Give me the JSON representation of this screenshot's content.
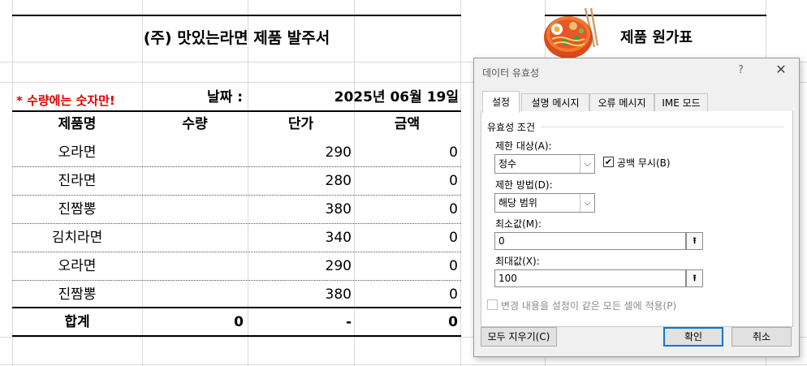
{
  "sheet": {
    "title": "(주) 맛있는라면 제품 발주서",
    "cost_table_title": "제품 원가표",
    "note": "* 수량에는 숫자만!",
    "date_label": "날짜 :",
    "date_value": "2025년 06월 19일",
    "note_color": "#e00000",
    "headers": [
      "제품명",
      "수량",
      "단가",
      "금액"
    ],
    "rows": [
      {
        "name": "오라면",
        "qty": "",
        "price": "290",
        "amount": "0"
      },
      {
        "name": "진라면",
        "qty": "",
        "price": "280",
        "amount": "0"
      },
      {
        "name": "진짬뽕",
        "qty": "",
        "price": "380",
        "amount": "0"
      },
      {
        "name": "김치라면",
        "qty": "",
        "price": "340",
        "amount": "0"
      },
      {
        "name": "오라면",
        "qty": "",
        "price": "290",
        "amount": "0"
      },
      {
        "name": "진짬뽕",
        "qty": "",
        "price": "380",
        "amount": "0"
      }
    ],
    "total": {
      "label": "합계",
      "qty": "0",
      "price": "-",
      "amount": "0"
    },
    "icon": "ramen-bowl-icon"
  },
  "dialog": {
    "title": "데이터 유효성",
    "help": "?",
    "close": "✕",
    "tabs": [
      "설정",
      "설명 메시지",
      "오류 메시지",
      "IME 모드"
    ],
    "active_tab": "설정",
    "group_title": "유효성 조건",
    "allow_label": "제한 대상(A):",
    "allow_value": "정수",
    "ignore_blank_label": "공백 무시(B)",
    "ignore_blank_checked": true,
    "data_label": "제한 방법(D):",
    "data_value": "해당 범위",
    "min_label": "최소값(M):",
    "min_value": "0",
    "max_label": "최대값(X):",
    "max_value": "100",
    "apply_all_label": "변경 내용을 설정이 같은 모든 셀에 적용(P)",
    "apply_all_checked": false,
    "clear_all_button": "모두 지우기(C)",
    "ok_button": "확인",
    "cancel_button": "취소",
    "accent_color": "#0078d7"
  }
}
